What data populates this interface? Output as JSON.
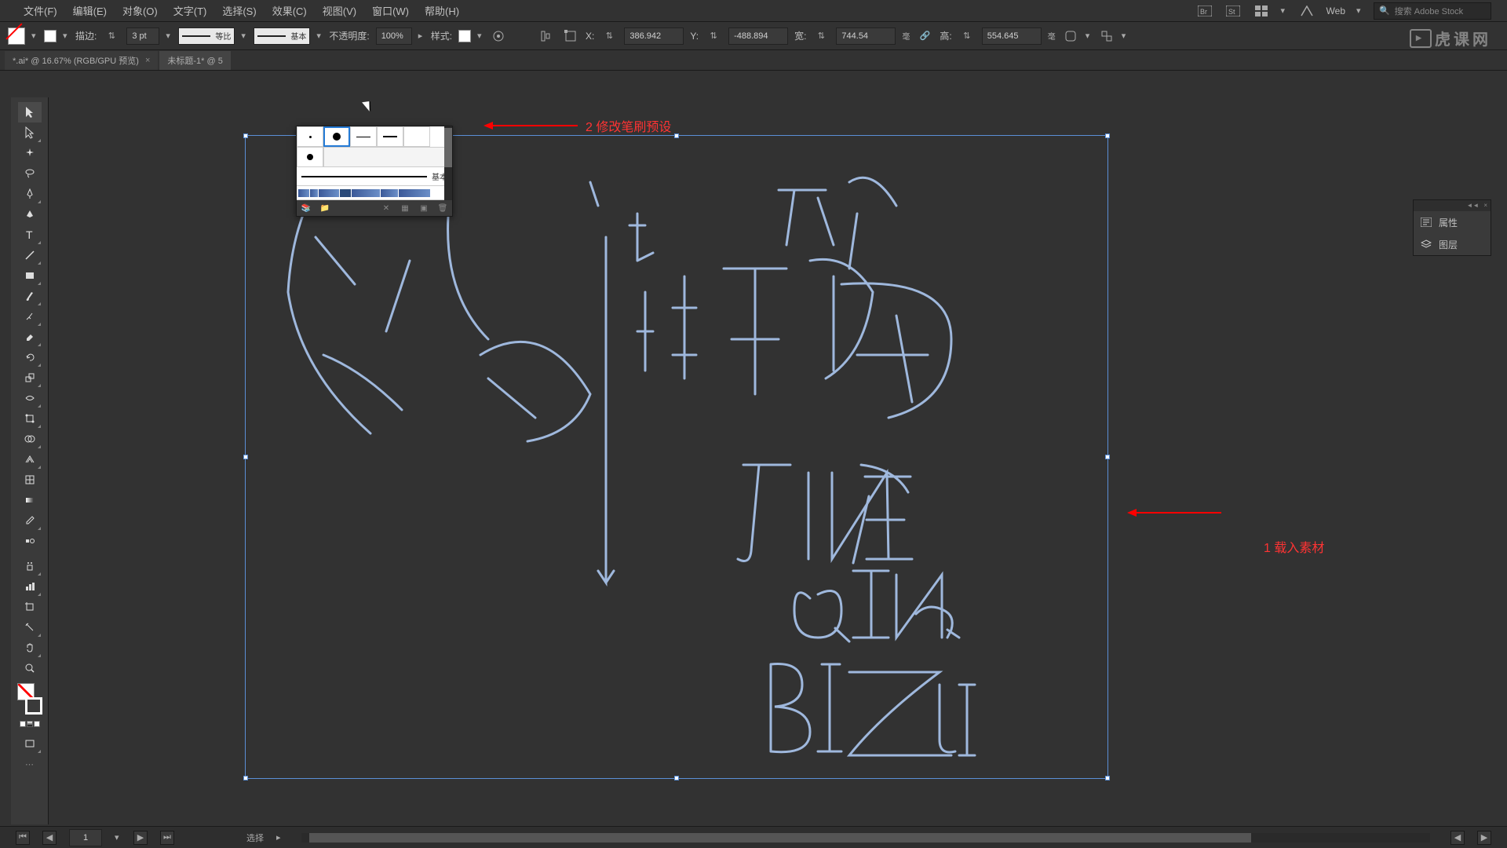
{
  "menubar": {
    "items": [
      "文件(F)",
      "编辑(E)",
      "对象(O)",
      "文字(T)",
      "选择(S)",
      "效果(C)",
      "视图(V)",
      "窗口(W)",
      "帮助(H)"
    ],
    "workspace": "Web",
    "search_placeholder": "搜索 Adobe Stock"
  },
  "control": {
    "stroke_label": "描边:",
    "stroke_weight": "3 pt",
    "profile_label": "等比",
    "brush_label": "基本",
    "opacity_label": "不透明度:",
    "opacity_value": "100%",
    "style_label": "样式:",
    "x_value": "386.942",
    "y_value": "-488.894",
    "w_value": "744.54",
    "h_value": "554.645",
    "unit": "毫"
  },
  "tabs": [
    {
      "label": "*.ai* @ 16.67% (RGB/GPU 预览)"
    },
    {
      "label": "未标题-1* @ 5"
    }
  ],
  "brush_panel": {
    "basic_label": "基本"
  },
  "annotations": {
    "a1": "1 载入素材",
    "a2": "2 修改笔刷预设"
  },
  "right_dock": {
    "items": [
      "属性",
      "图层"
    ]
  },
  "statusbar": {
    "artboard": "1",
    "tool_label": "选择"
  },
  "watermark": "虎课网"
}
